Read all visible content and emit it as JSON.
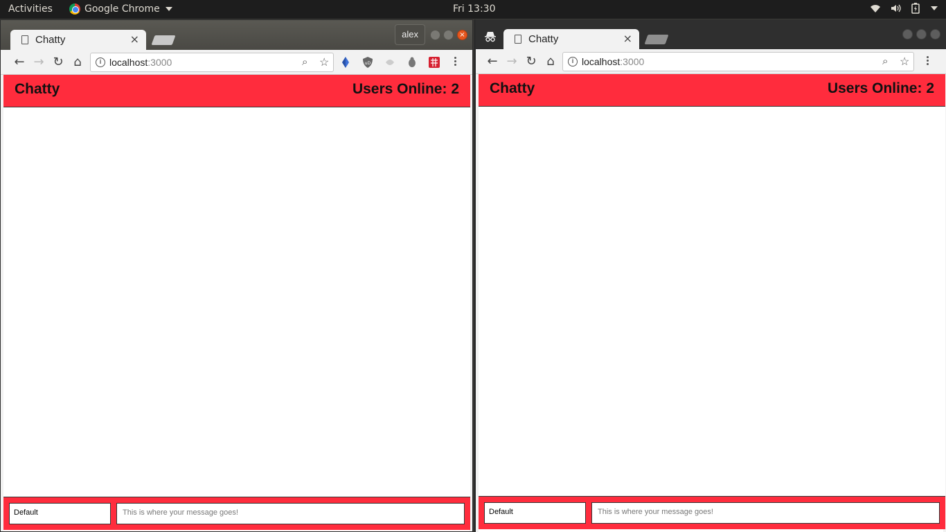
{
  "desktop": {
    "activities": "Activities",
    "app_menu": "Google Chrome",
    "clock": "Fri 13:30"
  },
  "left_window": {
    "tab_title": "Chatty",
    "profile": "alex",
    "url_host": "localhost",
    "url_port": ":3000",
    "app": {
      "brand": "Chatty",
      "users_online": "Users Online: 2",
      "username_value": "Default",
      "message_placeholder": "This is where your message goes!"
    }
  },
  "right_window": {
    "tab_title": "Chatty",
    "url_host": "localhost",
    "url_port": ":3000",
    "app": {
      "brand": "Chatty",
      "users_online": "Users Online: 2",
      "username_value": "Default",
      "message_placeholder": "This is where your message goes!"
    }
  },
  "colors": {
    "accent": "#ff2c3d",
    "topbar": "#1d1d1d"
  }
}
